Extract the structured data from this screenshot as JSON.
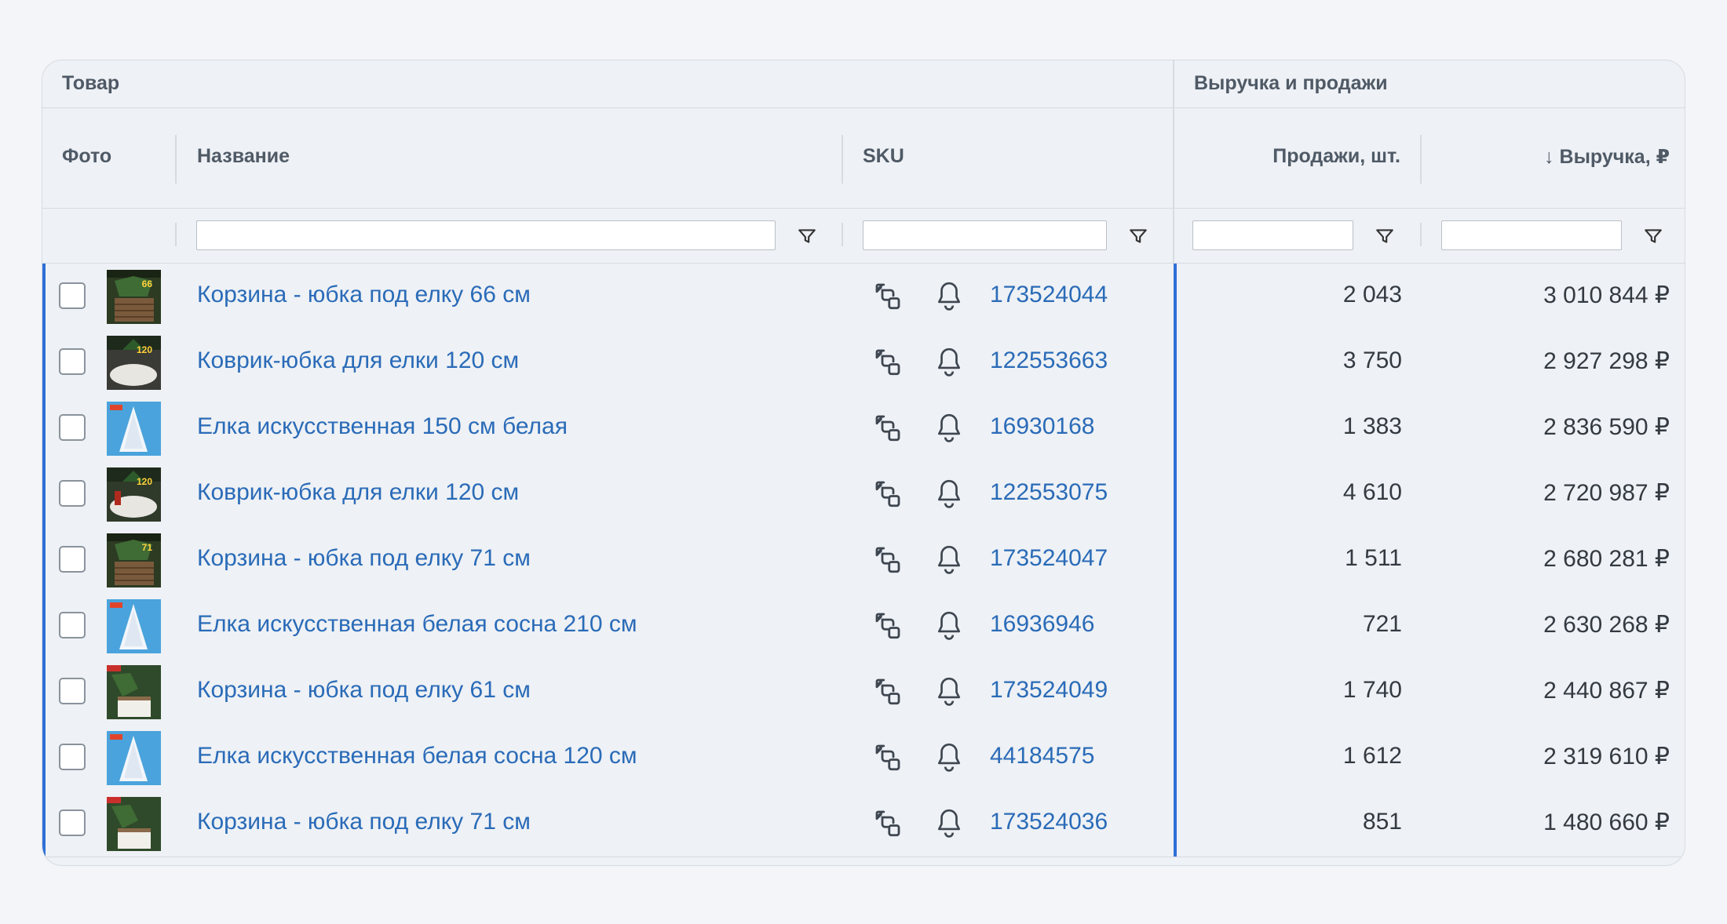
{
  "header": {
    "group_product": "Товар",
    "group_revenue": "Выручка и продажи",
    "col_photo": "Фото",
    "col_name": "Название",
    "col_sku": "SKU",
    "col_sales": "Продажи, шт.",
    "col_revenue": "↓ Выручка, ₽"
  },
  "filters": {
    "name_value": "",
    "sku_value": "",
    "sales_value": "",
    "revenue_value": ""
  },
  "colors": {
    "accent": "#2f6fd8",
    "link": "#2a6bb8",
    "background": "#eef1f5"
  },
  "rows": [
    {
      "name": "Корзина - юбка под елку 66 см",
      "sku": "173524044",
      "sales": "2 043",
      "revenue": "3 010 844 ₽",
      "thumb": "basket",
      "badge": "66"
    },
    {
      "name": "Коврик-юбка для елки 120 см",
      "sku": "122553663",
      "sales": "3 750",
      "revenue": "2 927 298 ₽",
      "thumb": "rug",
      "badge": "120"
    },
    {
      "name": "Елка искусственная 150 см белая",
      "sku": "16930168",
      "sales": "1 383",
      "revenue": "2 836 590 ₽",
      "thumb": "whitetree",
      "badge": ""
    },
    {
      "name": "Коврик-юбка для елки 120 см",
      "sku": "122553075",
      "sales": "4 610",
      "revenue": "2 720 987 ₽",
      "thumb": "rugdark",
      "badge": "120"
    },
    {
      "name": "Корзина - юбка под елку 71 см",
      "sku": "173524047",
      "sales": "1 511",
      "revenue": "2 680 281 ₽",
      "thumb": "basket",
      "badge": "71"
    },
    {
      "name": "Елка искусственная белая сосна 210 см",
      "sku": "16936946",
      "sales": "721",
      "revenue": "2 630 268 ₽",
      "thumb": "whitetree",
      "badge": ""
    },
    {
      "name": "Корзина - юбка под елку 61 см",
      "sku": "173524049",
      "sales": "1 740",
      "revenue": "2 440 867 ₽",
      "thumb": "basketred",
      "badge": ""
    },
    {
      "name": "Елка искусственная белая сосна 120 см",
      "sku": "44184575",
      "sales": "1 612",
      "revenue": "2 319 610 ₽",
      "thumb": "whitetree",
      "badge": ""
    },
    {
      "name": "Корзина - юбка под елку 71 см",
      "sku": "173524036",
      "sales": "851",
      "revenue": "1 480 660 ₽",
      "thumb": "basketred",
      "badge": ""
    }
  ]
}
